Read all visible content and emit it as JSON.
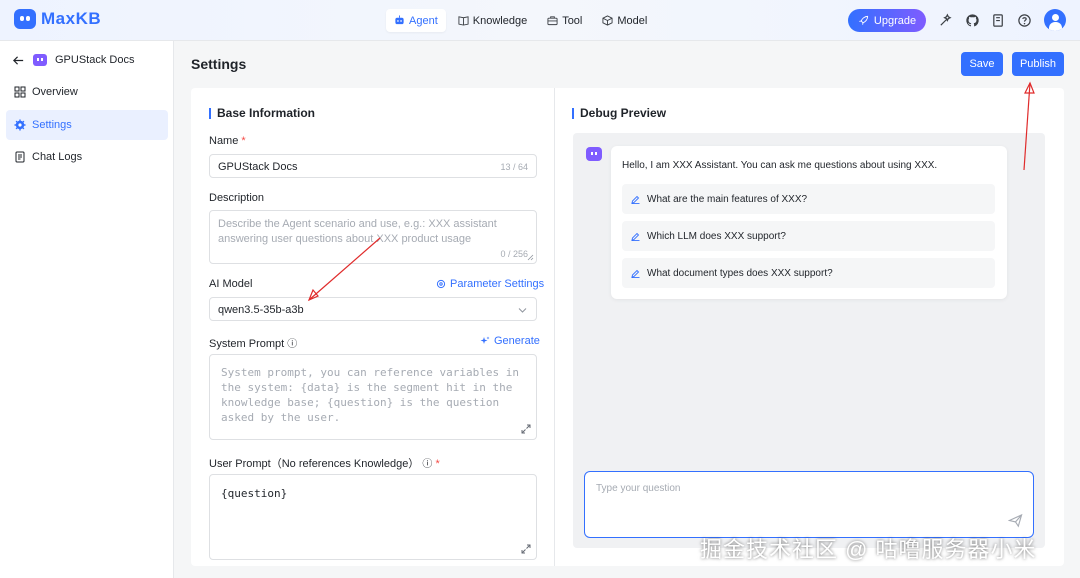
{
  "app": {
    "name": "MaxKB"
  },
  "nav": {
    "tabs": [
      {
        "label": "Agent",
        "active": true
      },
      {
        "label": "Knowledge"
      },
      {
        "label": "Tool"
      },
      {
        "label": "Model"
      }
    ],
    "upgrade_label": "Upgrade"
  },
  "sidebar": {
    "app_name": "GPUStack Docs",
    "items": [
      {
        "label": "Overview"
      },
      {
        "label": "Settings",
        "active": true
      },
      {
        "label": "Chat Logs"
      }
    ]
  },
  "header": {
    "title": "Settings",
    "save_label": "Save",
    "publish_label": "Publish"
  },
  "base_info": {
    "title": "Base Information",
    "name_label": "Name",
    "name_value": "GPUStack Docs",
    "name_counter": "13 / 64",
    "description_label": "Description",
    "description_placeholder": "Describe the Agent scenario and use, e.g.: XXX assistant answering user questions about XXX product usage",
    "description_counter": "0 / 256",
    "ai_model_label": "AI Model",
    "parameter_settings_label": "Parameter Settings",
    "ai_model_value": "qwen3.5-35b-a3b",
    "system_prompt_label": "System Prompt",
    "generate_label": "Generate",
    "system_prompt_placeholder": "System prompt, you can reference variables in the system: {data} is the segment hit in the knowledge base; {question} is the question asked by the user.",
    "user_prompt_label": "User Prompt（No references Knowledge）",
    "user_prompt_value": "{question}"
  },
  "debug": {
    "title": "Debug Preview",
    "greeting": "Hello, I am XXX Assistant. You can ask me questions about using XXX.",
    "suggestions": [
      "What are the main features of XXX?",
      "Which LLM does XXX support?",
      "What document types does XXX support?"
    ],
    "input_placeholder": "Type your question"
  },
  "watermark": "掘金技术社区 @ 咕噜服务器小米",
  "colors": {
    "accent": "#3370ff",
    "annotation": "#e02b2b",
    "brand_purple": "#7f5cff"
  }
}
